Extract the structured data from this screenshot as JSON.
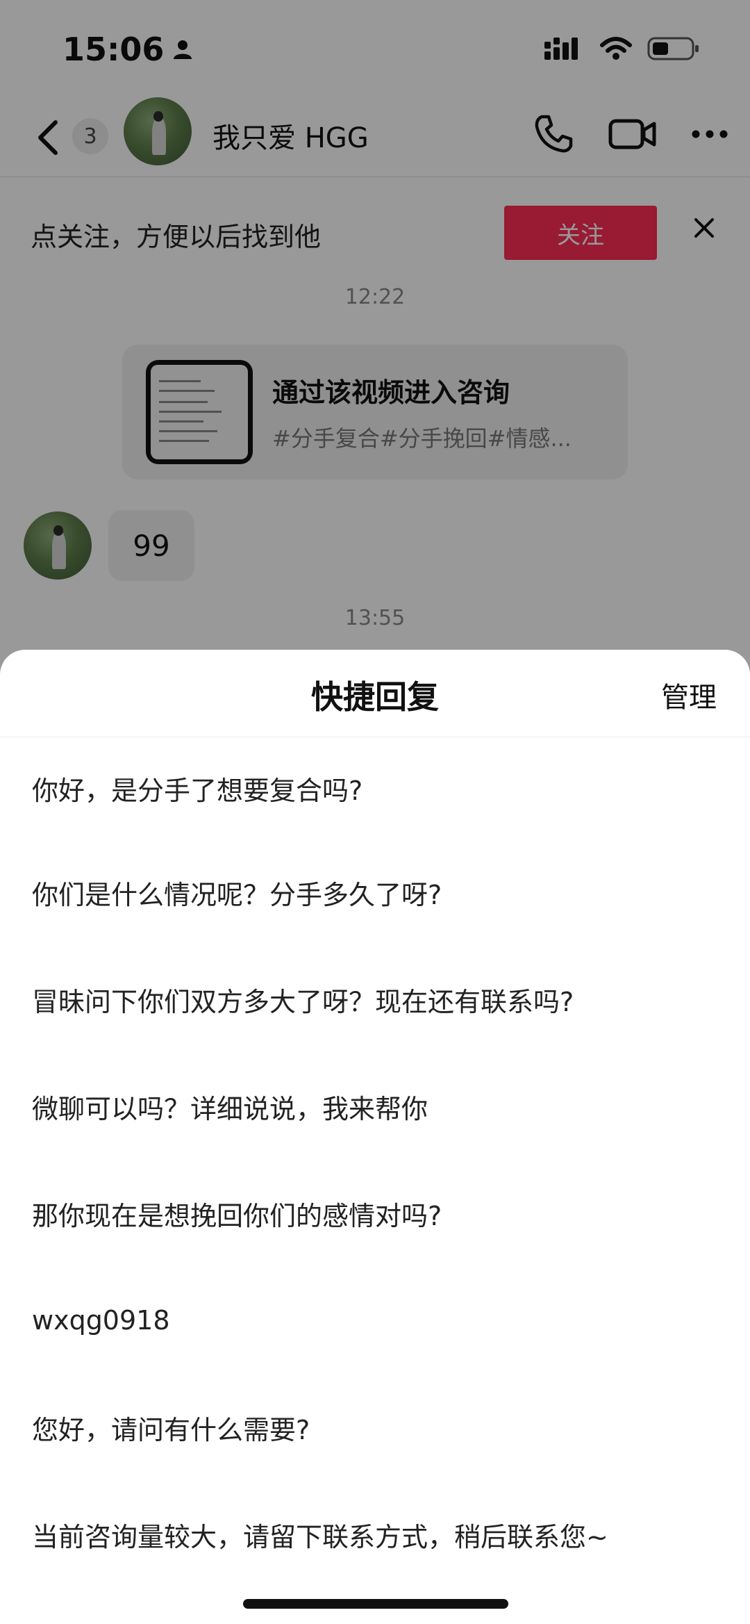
{
  "status_bar": {
    "time": "15:06"
  },
  "header": {
    "unread_count": "3",
    "contact_name": "我只爱 HGG"
  },
  "follow_bar": {
    "prompt": "点关注，方便以后找到他",
    "follow_label": "关注"
  },
  "messages": {
    "timestamp_1": "12:22",
    "card_title": "通过该视频进入咨询",
    "card_tags": "#分手复合#分手挽回#情感...",
    "bubble_text": "99",
    "timestamp_2": "13:55"
  },
  "quick_reply": {
    "title": "快捷回复",
    "manage_label": "管理",
    "items": [
      "你好，是分手了想要复合吗?",
      "你们是什么情况呢？分手多久了呀?",
      "冒昧问下你们双方多大了呀？现在还有联系吗?",
      "微聊可以吗？详细说说，我来帮你",
      "那你现在是想挽回你们的感情对吗?",
      "wxqg0918",
      "您好，请问有什么需要?",
      "当前咨询量较大，请留下联系方式，稍后联系您~"
    ]
  },
  "colors": {
    "follow_button": "#fe2c55",
    "overlay": "rgba(0,0,0,0.40)"
  }
}
